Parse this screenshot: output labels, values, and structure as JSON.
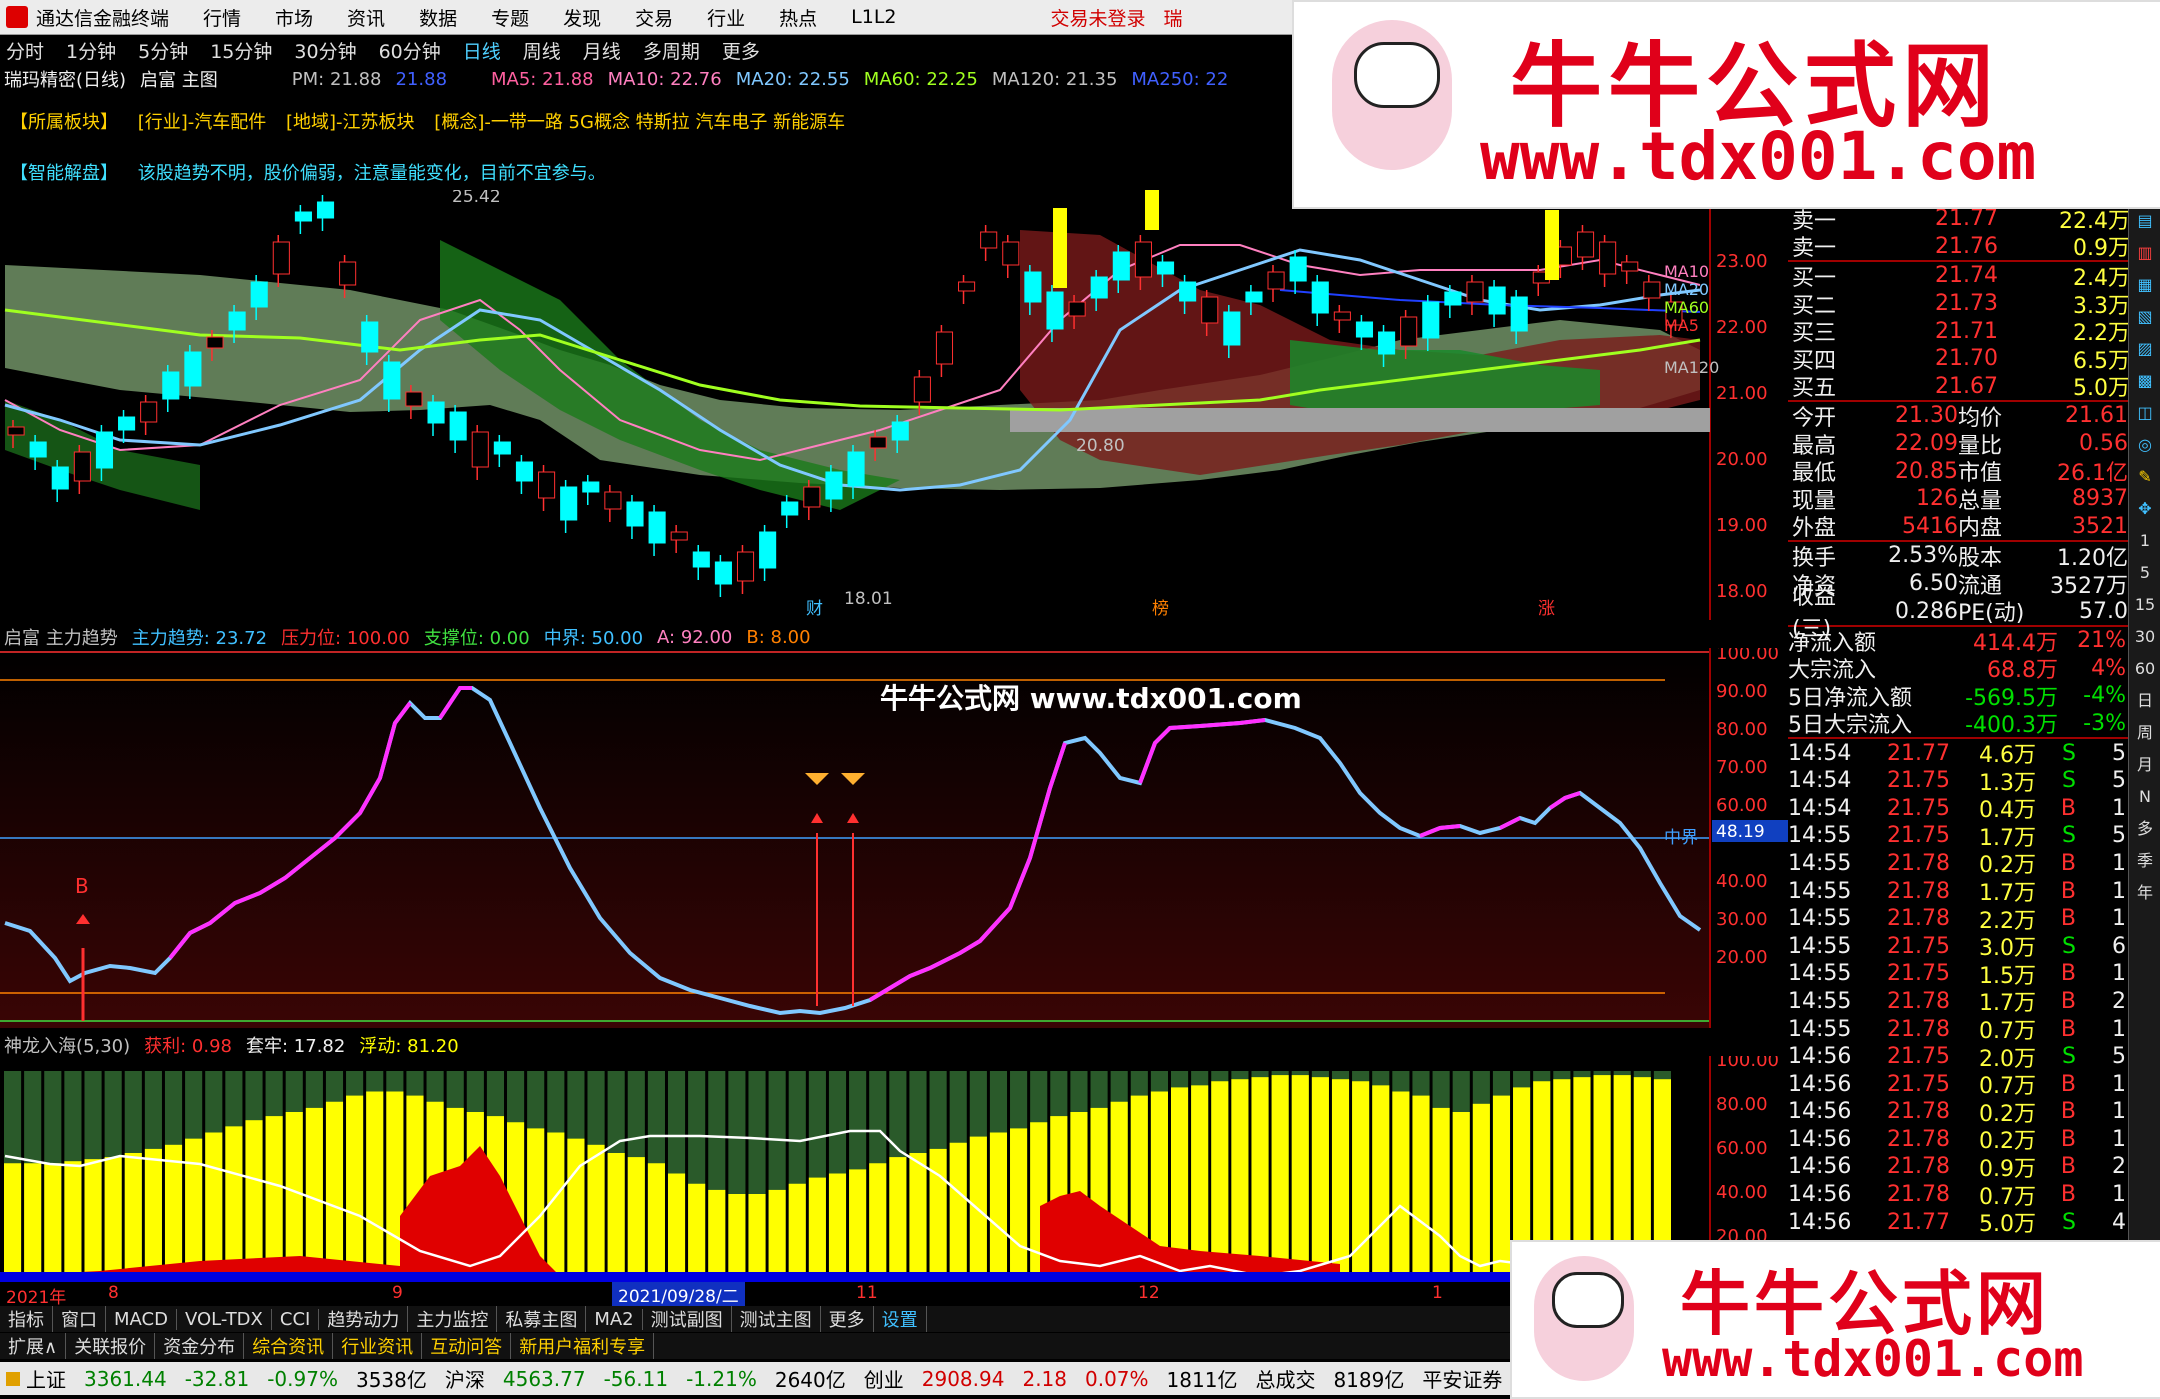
{
  "menu": {
    "app_title": "通达信金融终端",
    "items": [
      "行情",
      "市场",
      "资讯",
      "数据",
      "专题",
      "发现",
      "交易",
      "行业",
      "热点",
      "L1L2"
    ],
    "login_status": "交易未登录",
    "extra": "瑞"
  },
  "periods": {
    "items": [
      "分时",
      "1分钟",
      "5分钟",
      "15分钟",
      "30分钟",
      "60分钟",
      "日线",
      "周线",
      "月线",
      "多周期",
      "更多"
    ],
    "active": "日线"
  },
  "stock": {
    "name": "瑞玛精密(日线)",
    "main_chart": "启富 主图"
  },
  "ma": {
    "pm": "PM: 21.88",
    "pm2": "21.88",
    "ma5": "MA5: 21.88",
    "ma10": "MA10: 22.76",
    "ma20": "MA20: 22.55",
    "ma60": "MA60: 22.25",
    "ma120": "MA120: 21.35",
    "ma250": "MA250: 22"
  },
  "info": {
    "sector_label": "【所属板块】",
    "sector_1": "[行业]-汽车配件",
    "sector_2": "[地域]-江苏板块",
    "sector_3": "[概念]-一带一路 5G概念 特斯拉 汽车电子 新能源车",
    "smart_label": "【智能解盘】",
    "smart_text": "该股趋势不明，股价偏弱，注意量能变化，目前不宜参与。"
  },
  "price_axis": [
    "23.00",
    "22.00",
    "21.00",
    "20.00",
    "19.00",
    "18.00"
  ],
  "ma_tags": [
    "MA10",
    "MA20",
    "MA60",
    "MA5",
    "MA120"
  ],
  "main_annotations": {
    "high": "25.42",
    "low": "18.01",
    "mid_low": "20.80",
    "marker_cai": "财",
    "marker_bang": "榜",
    "marker_zhang": "涨"
  },
  "ind1": {
    "title": "启富 主力趋势",
    "main": "主力趋势: 23.72",
    "pressure": "压力位: 100.00",
    "support": "支撑位: 0.00",
    "midline": "中界: 50.00",
    "a": "A: 92.00",
    "b": "B: 8.00",
    "axis": [
      "100.00",
      "90.00",
      "80.00",
      "70.00",
      "60.00",
      "50.00",
      "40.00",
      "30.00",
      "20.00"
    ],
    "mid_tag": "中界",
    "mid_value": "48.19",
    "b_mark": "B",
    "watermark": "牛牛公式网 www.tdx001.com"
  },
  "ind2": {
    "title": "神龙入海(5,30)",
    "profit": "获利: 0.98",
    "trapped": "套牢: 17.82",
    "float": "浮动: 81.20",
    "axis": [
      "100.00",
      "80.00",
      "60.00",
      "40.00",
      "20.00"
    ]
  },
  "time_axis": {
    "year": "2021年",
    "m8": "8",
    "m9": "9",
    "date": "2021/09/28/二",
    "m11": "11",
    "m12": "12",
    "m1": "1"
  },
  "tabs1": [
    "指标",
    "窗口",
    "MACD",
    "VOL-TDX",
    "CCI",
    "趋势动力",
    "主力监控",
    "私募主图",
    "MA2",
    "测试副图",
    "测试主图",
    "更多",
    "设置"
  ],
  "tabs2": [
    "扩展∧",
    "关联报价",
    "资金分布",
    "综合资讯",
    "行业资讯",
    "互动问答",
    "新用户福利专享"
  ],
  "status": {
    "sh_label": "上证",
    "sh": "3361.44",
    "sh_chg": "-32.81",
    "sh_pct": "-0.97%",
    "sh_amt": "3538亿",
    "sz_label": "沪深",
    "sz": "4563.77",
    "sz_chg": "-56.11",
    "sz_pct": "-1.21%",
    "sz_amt": "2640亿",
    "cy_label": "创业",
    "cy": "2908.94",
    "cy_chg": "2.18",
    "cy_pct": "0.07%",
    "cy_amt": "1811亿",
    "total_label": "总成交",
    "total": "8189亿",
    "broker": "平安证券"
  },
  "orderbook": {
    "sells": [
      {
        "l": "卖一",
        "p": "21.77",
        "v": "22.4万"
      },
      {
        "l": "卖一",
        "p": "21.76",
        "v": "0.9万"
      }
    ],
    "buys": [
      {
        "l": "买一",
        "p": "21.74",
        "v": "2.4万"
      },
      {
        "l": "买二",
        "p": "21.73",
        "v": "3.3万"
      },
      {
        "l": "买三",
        "p": "21.71",
        "v": "2.2万"
      },
      {
        "l": "买四",
        "p": "21.70",
        "v": "6.5万"
      },
      {
        "l": "买五",
        "p": "21.67",
        "v": "5.0万"
      }
    ]
  },
  "quote": [
    {
      "a": "今开",
      "av": "21.30",
      "b": "均价",
      "bv": "21.61"
    },
    {
      "a": "最高",
      "av": "22.09",
      "b": "量比",
      "bv": "0.56"
    },
    {
      "a": "最低",
      "av": "20.85",
      "b": "市值",
      "bv": "26.1亿"
    },
    {
      "a": "现量",
      "av": "126",
      "b": "总量",
      "bv": "8937"
    },
    {
      "a": "外盘",
      "av": "5416",
      "b": "内盘",
      "bv": "3521"
    }
  ],
  "quote2": [
    {
      "a": "换手",
      "av": "2.53%",
      "b": "股本",
      "bv": "1.20亿"
    },
    {
      "a": "净资",
      "av": "6.50",
      "b": "流通",
      "bv": "3527万"
    },
    {
      "a": "收益(三)",
      "av": "0.286",
      "b": "PE(动)",
      "bv": "57.0"
    }
  ],
  "flows": [
    {
      "l": "净流入额",
      "v": "414.4万",
      "p": "21%"
    },
    {
      "l": "大宗流入",
      "v": "68.8万",
      "p": "4%"
    },
    {
      "l": "5日净流入额",
      "v": "-569.5万",
      "p": "-4%"
    },
    {
      "l": "5日大宗流入",
      "v": "-400.3万",
      "p": "-3%"
    }
  ],
  "ticks": [
    [
      "14:54",
      "21.77",
      "4.6万",
      "S",
      "5"
    ],
    [
      "14:54",
      "21.75",
      "1.3万",
      "S",
      "5"
    ],
    [
      "14:54",
      "21.75",
      "0.4万",
      "B",
      "1"
    ],
    [
      "14:55",
      "21.75",
      "1.7万",
      "S",
      "5"
    ],
    [
      "14:55",
      "21.78",
      "0.2万",
      "B",
      "1"
    ],
    [
      "14:55",
      "21.78",
      "1.7万",
      "B",
      "1"
    ],
    [
      "14:55",
      "21.78",
      "2.2万",
      "B",
      "1"
    ],
    [
      "14:55",
      "21.75",
      "3.0万",
      "S",
      "6"
    ],
    [
      "14:55",
      "21.75",
      "1.5万",
      "B",
      "1"
    ],
    [
      "14:55",
      "21.78",
      "1.7万",
      "B",
      "2"
    ],
    [
      "14:55",
      "21.78",
      "0.7万",
      "B",
      "1"
    ],
    [
      "14:56",
      "21.75",
      "2.0万",
      "S",
      "5"
    ],
    [
      "14:56",
      "21.75",
      "0.7万",
      "B",
      "1"
    ],
    [
      "14:56",
      "21.78",
      "0.2万",
      "B",
      "1"
    ],
    [
      "14:56",
      "21.78",
      "0.2万",
      "B",
      "1"
    ],
    [
      "14:56",
      "21.78",
      "0.9万",
      "B",
      "2"
    ],
    [
      "14:56",
      "21.78",
      "0.7万",
      "B",
      "1"
    ],
    [
      "14:56",
      "21.77",
      "5.0万",
      "S",
      "4"
    ]
  ],
  "sidebar": [
    "1",
    "5",
    "15",
    "30",
    "60",
    "日",
    "周",
    "月",
    "N",
    "多",
    "季",
    "年"
  ],
  "watermark": {
    "brand": "牛牛公式网",
    "url": "www.tdx001.com"
  },
  "colors": {
    "up": "#ff3030",
    "down": "#00ffff",
    "ma_pink": "#ff80c0",
    "ma_blue": "#80c8ff",
    "ma_green": "#a0ff20",
    "yellow": "#ffff00"
  }
}
